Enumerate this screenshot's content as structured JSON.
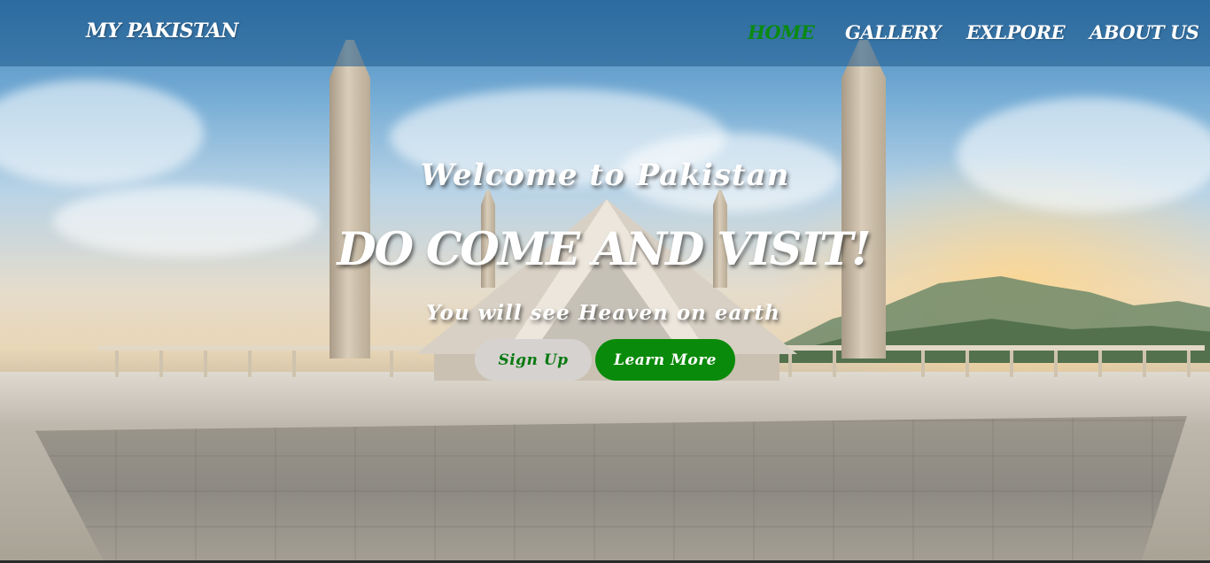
{
  "nav": {
    "brand": "MY PAKISTAN",
    "links": [
      {
        "label": "HOME",
        "active": true
      },
      {
        "label": "GALLERY",
        "active": false
      },
      {
        "label": "EXLPORE",
        "active": false
      },
      {
        "label": "ABOUT US",
        "active": false
      }
    ]
  },
  "hero": {
    "welcome": "Welcome to Pakistan",
    "headline": "DO COME AND VISIT!",
    "tagline": "You will see Heaven on earth",
    "buttons": {
      "signup": "Sign Up",
      "learn_more": "Learn More"
    }
  },
  "colors": {
    "accent_green": "#0a8a0a",
    "nav_overlay": "rgba(30,90,140,0.55)",
    "signup_bg": "#d6d2cf"
  },
  "background_image": "faisal-mosque-photo"
}
